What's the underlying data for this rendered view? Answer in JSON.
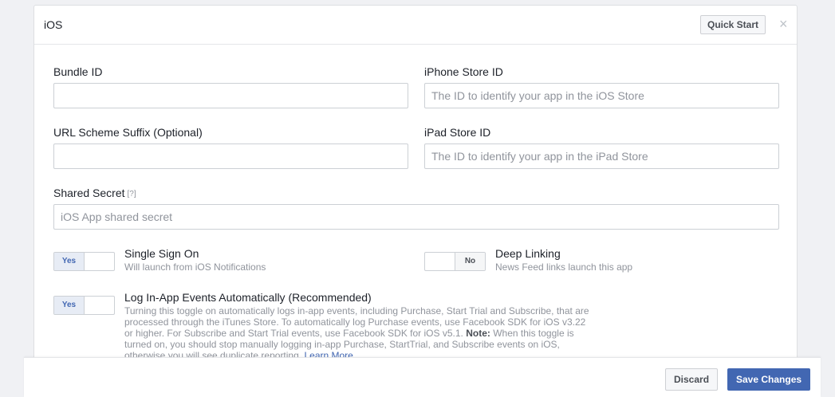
{
  "panel": {
    "title": "iOS",
    "quick_start_label": "Quick Start",
    "close_glyph": "×"
  },
  "fields": {
    "bundle_id": {
      "label": "Bundle ID",
      "value": "",
      "placeholder": ""
    },
    "iphone_store_id": {
      "label": "iPhone Store ID",
      "value": "",
      "placeholder": "The ID to identify your app in the iOS Store"
    },
    "url_scheme_suffix": {
      "label": "URL Scheme Suffix (Optional)",
      "value": "",
      "placeholder": ""
    },
    "ipad_store_id": {
      "label": "iPad Store ID",
      "value": "",
      "placeholder": "The ID to identify your app in the iPad Store"
    },
    "shared_secret": {
      "label": "Shared Secret",
      "help": "[?]",
      "value": "",
      "placeholder": "iOS App shared secret"
    }
  },
  "toggles": {
    "single_sign_on": {
      "state": "Yes",
      "title": "Single Sign On",
      "description": "Will launch from iOS Notifications"
    },
    "deep_linking": {
      "state": "No",
      "title": "Deep Linking",
      "description": "News Feed links launch this app"
    },
    "log_events": {
      "state": "Yes",
      "title": "Log In-App Events Automatically (Recommended)",
      "description": "Turning this toggle on automatically logs in-app events, including Purchase, Start Trial and Subscribe, that are processed through the iTunes Store. To automatically log Purchase events, use Facebook SDK for iOS v3.22 or higher. For Subscribe and Start Trial events, use Facebook SDK for iOS v5.1.",
      "note_label": "Note:",
      "note_text": "When this toggle is turned on, you should stop manually logging in-app Purchase, StartTrial, and Subscribe events on iOS, otherwise you will see duplicate reporting.",
      "learn_more": "Learn More"
    }
  },
  "footer": {
    "discard_label": "Discard",
    "save_label": "Save Changes"
  },
  "colors": {
    "accent": "#4267b2",
    "background": "#f0f1f4"
  }
}
